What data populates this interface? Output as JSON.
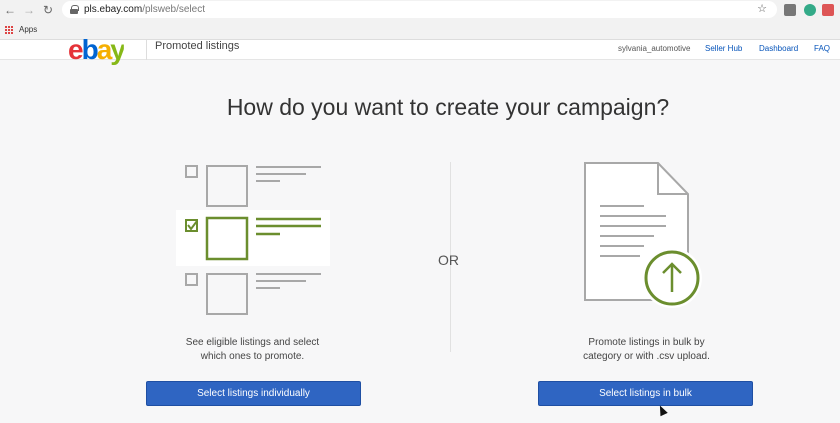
{
  "browser": {
    "url_host": "pls.ebay.com",
    "url_path": "/plsweb/select",
    "bookmarks_apps_label": "Apps"
  },
  "header": {
    "product_name": "Promoted listings",
    "username": "sylvania_automotive",
    "links": [
      "Seller Hub",
      "Dashboard",
      "FAQ"
    ]
  },
  "main": {
    "heading": "How do you want to create your campaign?",
    "or_label": "OR",
    "individual": {
      "description_line1": "See eligible listings and select",
      "description_line2": "which ones to promote.",
      "button_label": "Select listings individually"
    },
    "bulk": {
      "description_line1": "Promote listings in bulk by",
      "description_line2": "category or with .csv upload.",
      "button_label": "Select listings in bulk"
    }
  },
  "colors": {
    "primary_button": "#2f65c2",
    "link": "#0654ba",
    "illustration_green": "#6b8e2e",
    "illustration_gray": "#a8a8a8"
  }
}
